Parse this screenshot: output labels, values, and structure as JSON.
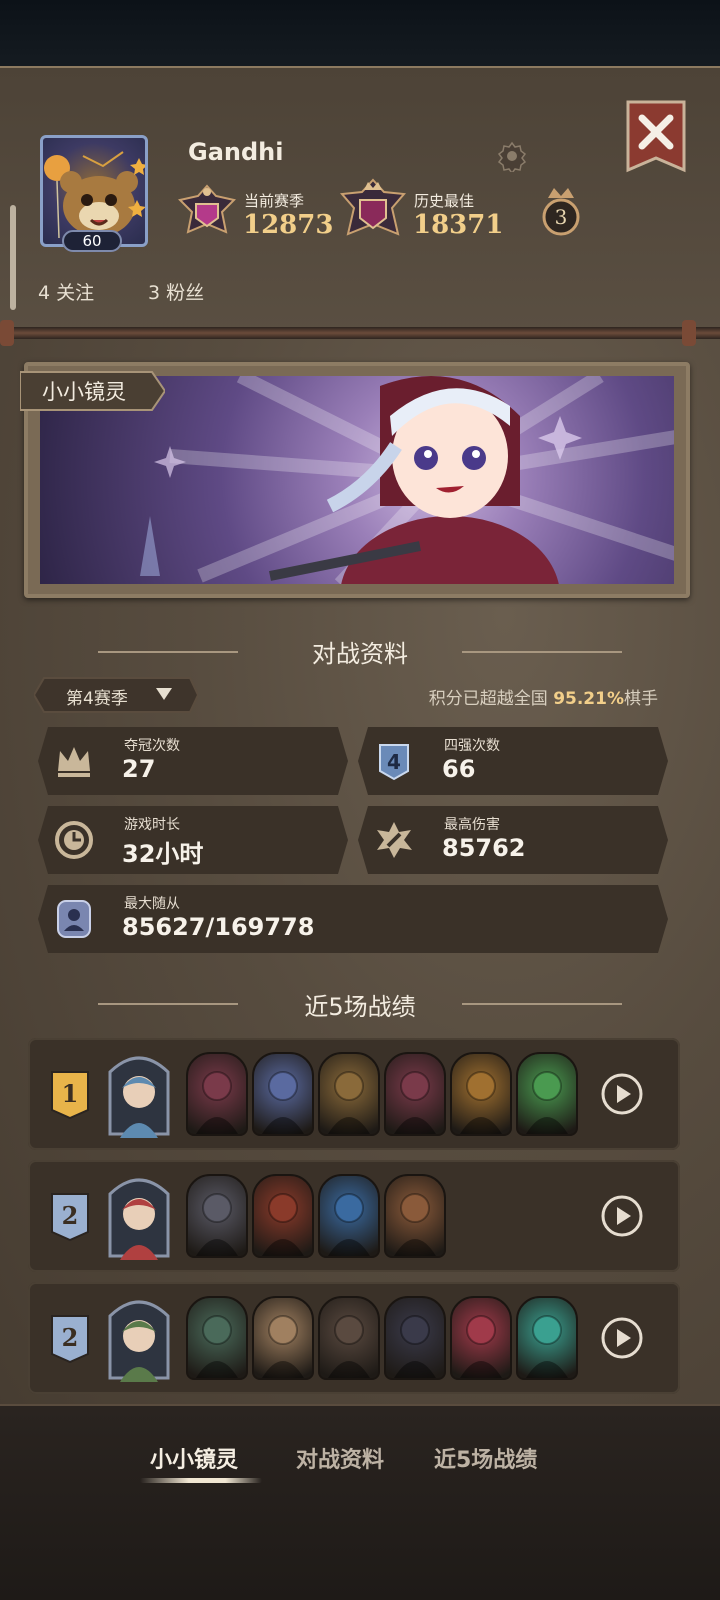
{
  "profile": {
    "name": "Gandhi",
    "level": "60",
    "current_season_label": "当前赛季",
    "current_season_score": "12873",
    "best_label": "历史最佳",
    "best_score": "18371",
    "rank_crown": "3",
    "following": "4 关注",
    "followers": "3 粉丝"
  },
  "hero_banner": {
    "name": "小小镜灵"
  },
  "battle_stats": {
    "section_title": "对战资料",
    "season_selector": "第4赛季",
    "rank_prefix": "积分已超越全国",
    "rank_pct": "95.21%",
    "rank_suffix": "棋手",
    "cards": [
      {
        "label": "夺冠次数",
        "value": "27",
        "icon": "crown-icon"
      },
      {
        "label": "四强次数",
        "value": "66",
        "icon": "top4-icon",
        "icon_text": "4"
      },
      {
        "label": "游戏时长",
        "value": "32小时",
        "icon": "clock-icon"
      },
      {
        "label": "最高伤害",
        "value": "85762",
        "icon": "damage-icon"
      },
      {
        "label": "最大随从",
        "value": "85627/169778",
        "icon": "minion-icon"
      }
    ]
  },
  "recent": {
    "section_title": "近5场战绩",
    "matches": [
      {
        "place": "1",
        "place_color": "#e8b44a",
        "hero_color": "#5d8ab0",
        "units": [
          "#7a3a4a",
          "#5a6aa0",
          "#8a6a3a",
          "#7a3a4a",
          "#a07030",
          "#4a9a50"
        ]
      },
      {
        "place": "2",
        "place_color": "#9ab0d0",
        "hero_color": "#b04040",
        "units": [
          "#5a5a66",
          "#8a3a2a",
          "#3a6aa0",
          "#8a5a3a"
        ]
      },
      {
        "place": "2",
        "place_color": "#9ab0d0",
        "hero_color": "#5a7a4a",
        "units": [
          "#4a6a5a",
          "#a08060",
          "#5a4a40",
          "#3a3a4a",
          "#a03a4a",
          "#3aa090"
        ]
      }
    ]
  },
  "bottom_nav": {
    "items": [
      "小小镜灵",
      "对战资料",
      "近5场战绩"
    ],
    "active": 0
  },
  "colors": {
    "accent_gold": "#f2cf8a",
    "panel": "#574c3f"
  }
}
